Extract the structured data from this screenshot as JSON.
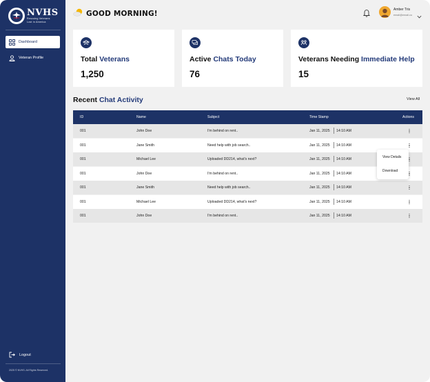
{
  "sidebar": {
    "logo": {
      "name": "NVHS",
      "tagline_1": "Rescuing Veterans",
      "tagline_2": "Lost in America"
    },
    "items": [
      {
        "label": "Dashboard",
        "icon": "grid-icon",
        "active": true
      },
      {
        "label": "Veteran Profile",
        "icon": "user-icon",
        "active": false
      }
    ],
    "logout_label": "Logout",
    "copyright": "2025 © NVHS. All Rights Reserved."
  },
  "header": {
    "greeting": "GOOD MORNING!",
    "user_name": "Amber Tris",
    "user_email": "email@email.co"
  },
  "cards": [
    {
      "title_plain": "Total ",
      "title_accent": "Veterans",
      "title_tail": "",
      "value": "1,250",
      "icon": "veterans-group-icon"
    },
    {
      "title_plain": "Active ",
      "title_accent": "Chats Today",
      "title_tail": "",
      "value": "76",
      "icon": "chat-bubbles-icon"
    },
    {
      "title_plain": "Veterans Needing ",
      "title_accent": "Immediate Help",
      "title_tail": "",
      "value": "15",
      "icon": "help-people-icon"
    }
  ],
  "section": {
    "title_plain": "Recent ",
    "title_accent": "Chat Activity",
    "view_all": "View All"
  },
  "table": {
    "headers": {
      "id": "ID",
      "name": "Name",
      "subject": "Subject",
      "timestamp": "Time Stamp",
      "actions": "Actions"
    },
    "rows": [
      {
        "id": "001",
        "name": "John Doe",
        "subject": "I'm behind on rent..",
        "date": "Jan 11, 2025",
        "time": "14:10 AM"
      },
      {
        "id": "001",
        "name": "Jane Smith",
        "subject": "Need help with job search..",
        "date": "Jan 11, 2025",
        "time": "14:10 AM"
      },
      {
        "id": "001",
        "name": "Michael Lee",
        "subject": "Uploaded DD214, what's next?",
        "date": "Jan 11, 2025",
        "time": "14:10 AM"
      },
      {
        "id": "001",
        "name": "John Doe",
        "subject": "I'm behind on rent..",
        "date": "Jan 11, 2025",
        "time": "14:10 AM"
      },
      {
        "id": "001",
        "name": "Jane Smith",
        "subject": "Need help with job search..",
        "date": "Jan 11, 2025",
        "time": "14:10 AM"
      },
      {
        "id": "001",
        "name": "Michael Lee",
        "subject": "Uploaded DD214, what's next?",
        "date": "Jan 11, 2025",
        "time": "14:10 AM"
      },
      {
        "id": "001",
        "name": "John Doe",
        "subject": "I'm behind on rent..",
        "date": "Jan 11, 2025",
        "time": "14:10 AM"
      }
    ]
  },
  "row_menu": {
    "view_details": "View Details",
    "download": "Download"
  },
  "colors": {
    "sidebar": "#1d3266",
    "accent": "#233a79",
    "row_alt": "#e6e6e6",
    "background": "#f1f1f1"
  }
}
